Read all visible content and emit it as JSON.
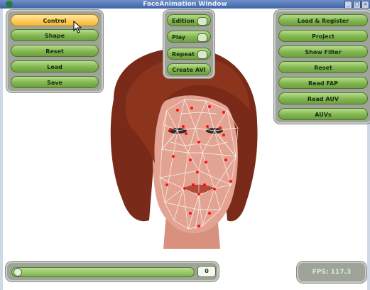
{
  "window": {
    "title": "FaceAnimation Window",
    "controls": [
      "_",
      "□",
      "×"
    ]
  },
  "left_panel": {
    "buttons": [
      {
        "label": "Control",
        "active": true
      },
      {
        "label": "Shape",
        "active": false
      },
      {
        "label": "Reset",
        "active": false
      },
      {
        "label": "Load",
        "active": false
      },
      {
        "label": "Save",
        "active": false
      }
    ]
  },
  "center_panel": {
    "toggles": [
      {
        "label": "Edition",
        "checked": false
      },
      {
        "label": "Play",
        "checked": false
      },
      {
        "label": "Repeat",
        "checked": false
      }
    ],
    "create_label": "Create AVI"
  },
  "right_panel": {
    "buttons": [
      {
        "label": "Load & Register"
      },
      {
        "label": "Project"
      },
      {
        "label": "Show Filter"
      },
      {
        "label": "Reset"
      },
      {
        "label": "Read FAP"
      },
      {
        "label": "Read AUV"
      },
      {
        "label": "AUVs"
      }
    ]
  },
  "timeline": {
    "value": "0",
    "position": 0
  },
  "status": {
    "fps": "FPS: 117.3"
  },
  "colors": {
    "button_green": "#82b650",
    "button_active": "#ffcb5a",
    "panel_gray": "#9ea49a",
    "hair": "#7a2a18",
    "skin": "#e3a392",
    "mesh_line": "#ffffff",
    "feature_point": "#ff1010"
  }
}
